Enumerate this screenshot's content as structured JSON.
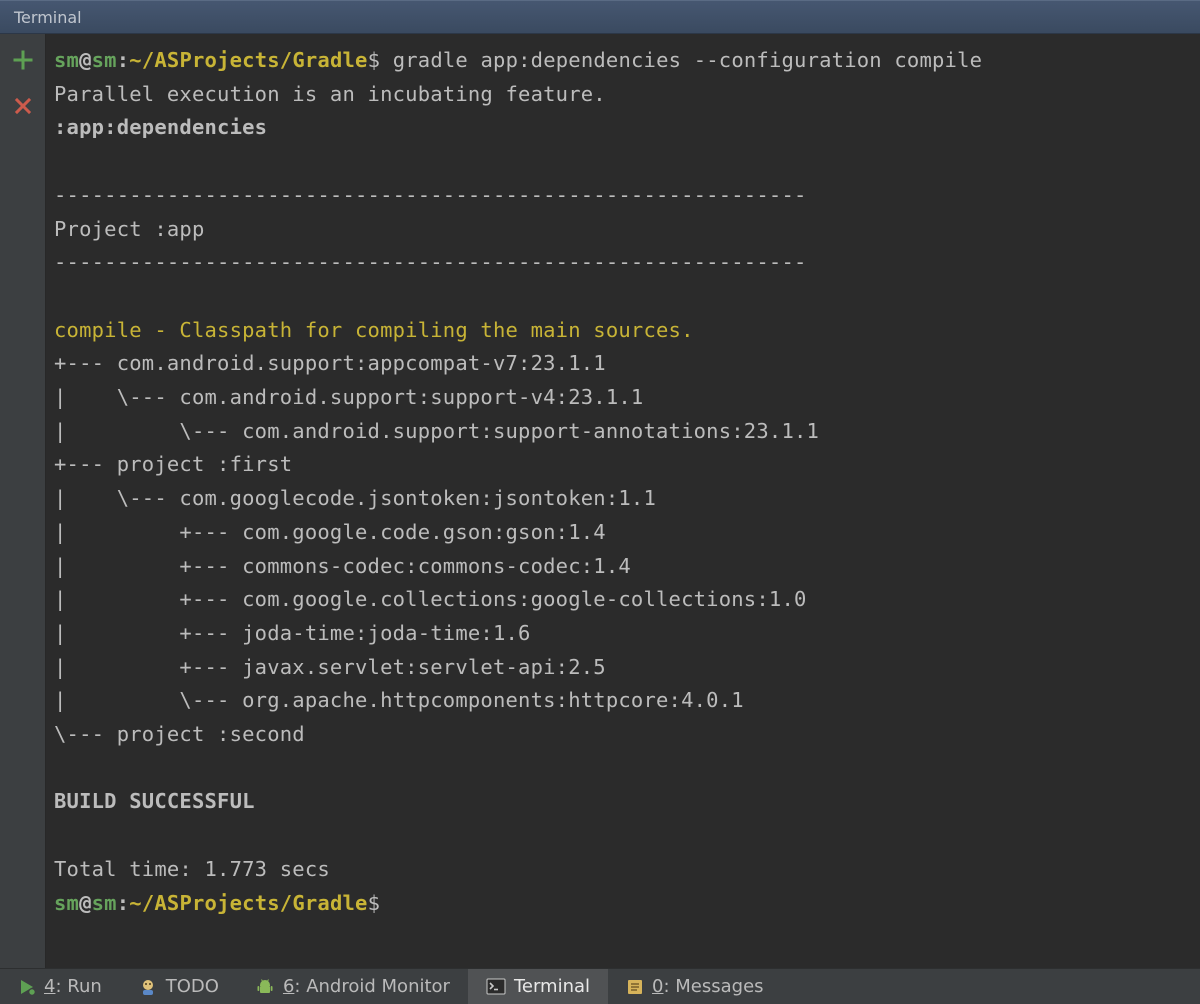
{
  "title_bar": {
    "label": "Terminal"
  },
  "toolbar": {
    "add_label": "Add Terminal",
    "close_label": "Close Terminal"
  },
  "prompt": {
    "user": "sm",
    "at": "@",
    "host": "sm",
    "colon": ":",
    "path": "~/ASProjects/Gradle",
    "dollar": "$",
    "command": "gradle app:dependencies --configuration compile"
  },
  "output": {
    "parallel": "Parallel execution is an incubating feature.",
    "task": ":app:dependencies",
    "rule": "------------------------------------------------------------",
    "project": "Project :app",
    "config_line": "compile - Classpath for compiling the main sources.",
    "tree": [
      "+--- com.android.support:appcompat-v7:23.1.1",
      "|    \\--- com.android.support:support-v4:23.1.1",
      "|         \\--- com.android.support:support-annotations:23.1.1",
      "+--- project :first",
      "|    \\--- com.googlecode.jsontoken:jsontoken:1.1",
      "|         +--- com.google.code.gson:gson:1.4",
      "|         +--- commons-codec:commons-codec:1.4",
      "|         +--- com.google.collections:google-collections:1.0",
      "|         +--- joda-time:joda-time:1.6",
      "|         +--- javax.servlet:servlet-api:2.5",
      "|         \\--- org.apache.httpcomponents:httpcore:4.0.1",
      "\\--- project :second"
    ],
    "build": "BUILD SUCCESSFUL",
    "time": "Total time: 1.773 secs"
  },
  "bottom_bar": {
    "run": {
      "key": "4",
      "label": ": Run"
    },
    "todo": {
      "label": "TODO"
    },
    "monitor": {
      "key": "6",
      "label": ": Android Monitor"
    },
    "terminal": {
      "label": "Terminal"
    },
    "messages": {
      "key": "0",
      "label": ": Messages"
    }
  }
}
